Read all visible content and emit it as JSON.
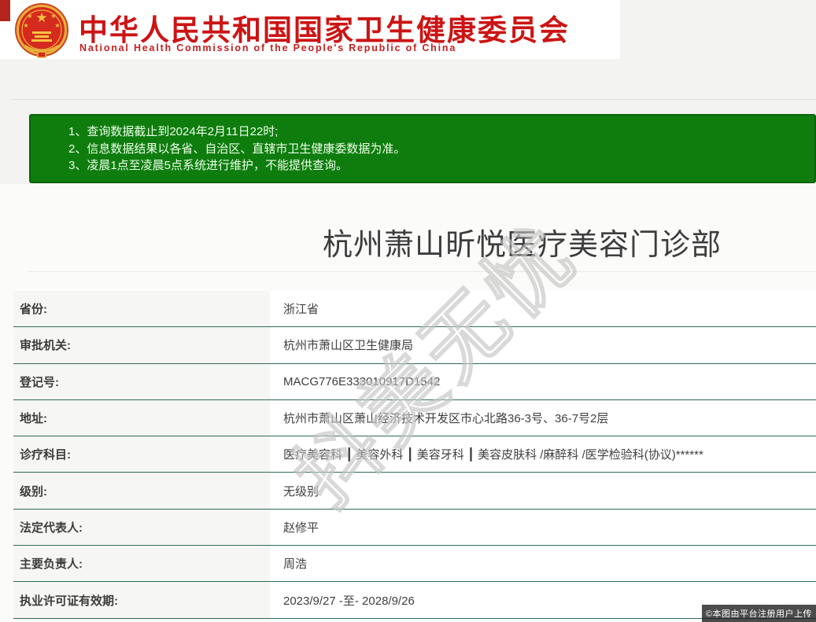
{
  "header": {
    "title_cn": "中华人民共和国国家卫生健康委员会",
    "title_en": "National Health Commission of the People's Republic of China",
    "emblem_icon": "china-national-emblem"
  },
  "notice": {
    "lines": [
      "1、查询数据截止到2024年2月11日22时;",
      "2、信息数据结果以各省、自治区、直辖市卫生健康委数据为准。",
      "3、凌晨1点至凌晨5点系统进行维护，不能提供查询。"
    ]
  },
  "record": {
    "title": "杭州萧山昕悦医疗美容门诊部",
    "fields": [
      {
        "label": "省份:",
        "value": "浙江省"
      },
      {
        "label": "审批机关:",
        "value": "杭州市萧山区卫生健康局"
      },
      {
        "label": "登记号:",
        "value": "MACG776E333010917D1542"
      },
      {
        "label": "地址:",
        "value": "杭州市萧山区萧山经济技术开发区市心北路36-3号、36-7号2层"
      },
      {
        "label": "诊疗科目:",
        "value": "医疗美容科 ┃ 美容外科 ┃ 美容牙科 ┃ 美容皮肤科 /麻醉科 /医学检验科(协议)******"
      },
      {
        "label": "级别:",
        "value": "无级别"
      },
      {
        "label": "法定代表人:",
        "value": "赵修平"
      },
      {
        "label": "主要负责人:",
        "value": "周浩"
      },
      {
        "label": "执业许可证有效期:",
        "value": "2023/9/27 -至- 2028/9/26"
      }
    ]
  },
  "watermark": "抖美无忧",
  "footer": {
    "copyright_badge": "©本图由平台注册用户上传"
  },
  "colors": {
    "brand_red": "#cc1414",
    "notice_green": "#0e7d0e",
    "notice_border_green": "#0a630a",
    "row_divider_teal": "#2f6b5a"
  }
}
